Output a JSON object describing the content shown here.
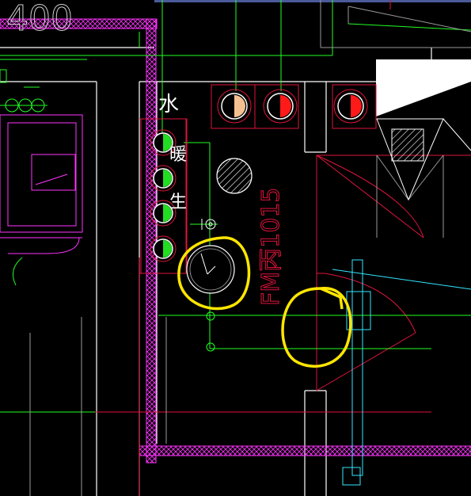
{
  "drawing": {
    "dimension_text": "400",
    "door_label": "FM丙1015",
    "label_water": "水",
    "label_side_a": "暖",
    "label_side_b": "生",
    "colors": {
      "background": "#000000",
      "wall_white": "#ffffff",
      "grid_red": "#e0143c",
      "green_line": "#22ff22",
      "magenta_hatch": "#ff33ff",
      "cyan": "#33e6ff",
      "yellow_markup": "#ffe600",
      "gray_line": "#9a9a9a"
    }
  }
}
